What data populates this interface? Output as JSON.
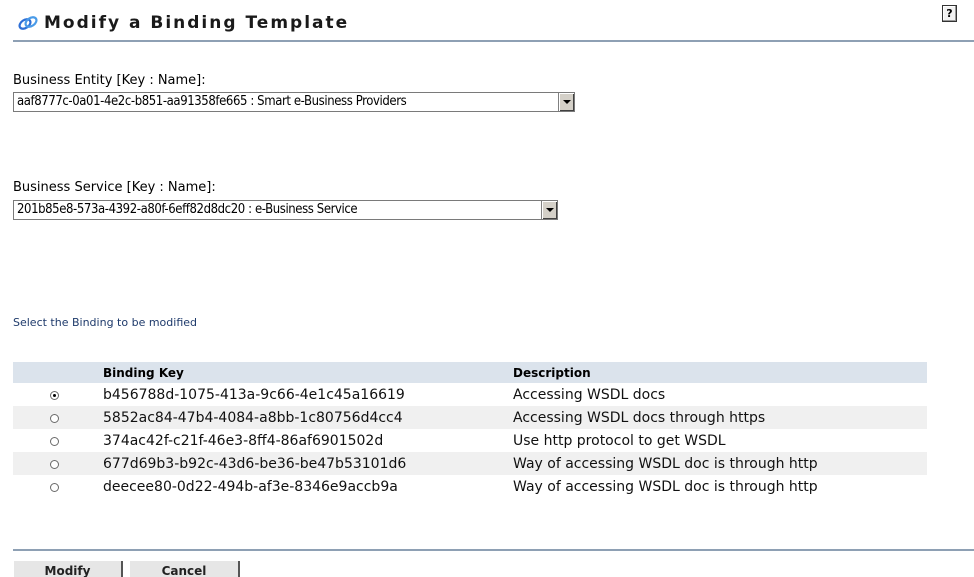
{
  "header": {
    "title": "Modify a Binding Template",
    "help_label": "?"
  },
  "business_entity": {
    "label": "Business Entity [Key : Name]:",
    "selected": "aaf8777c-0a01-4e2c-b851-aa91358fe665 : Smart e-Business Providers"
  },
  "business_service": {
    "label": "Business Service [Key : Name]:",
    "selected": "201b85e8-573a-4392-a80f-6eff82d8dc20 : e-Business Service"
  },
  "instruction": "Select the Binding to be modified",
  "table": {
    "columns": [
      "",
      "Binding Key",
      "Description"
    ],
    "rows": [
      {
        "selected": true,
        "key": "b456788d-1075-413a-9c66-4e1c45a16619",
        "description": "Accessing WSDL docs"
      },
      {
        "selected": false,
        "key": "5852ac84-47b4-4084-a8bb-1c80756d4cc4",
        "description": "Accessing WSDL docs through https"
      },
      {
        "selected": false,
        "key": "374ac42f-c21f-46e3-8ff4-86af6901502d",
        "description": "Use http protocol to get WSDL"
      },
      {
        "selected": false,
        "key": "677d69b3-b92c-43d6-be36-be47b53101d6",
        "description": "Way of accessing WSDL doc is through http"
      },
      {
        "selected": false,
        "key": "deecee80-0d22-494b-af3e-8346e9accb9a",
        "description": "Way of accessing WSDL doc is through http"
      }
    ]
  },
  "buttons": {
    "modify": "Modify",
    "cancel": "Cancel"
  },
  "colors": {
    "rule": "#8ea0b4",
    "table_header": "#dbe3ec",
    "instruction_text": "#1e3a6b"
  },
  "icons": {
    "title": "binding-template-icon",
    "help": "help-icon"
  }
}
